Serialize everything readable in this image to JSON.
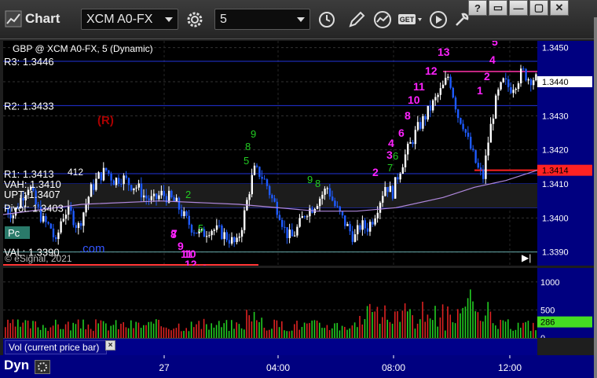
{
  "app": {
    "title": "Chart"
  },
  "toolbar": {
    "symbol": "XCM A0-FX",
    "interval": "5",
    "get_label": "GET"
  },
  "window_controls": [
    "?",
    "▭",
    "—",
    "▢",
    "✕"
  ],
  "chart": {
    "header": "GBP @ XCM A0-FX, 5 (Dynamic)",
    "copyright": "© eSignal, 2021",
    "watermark": ".com",
    "colors": {
      "background": "#000000",
      "axis_bg": "#000080",
      "up_candle": "#ffffff",
      "down_candle": "#1e5bff",
      "level_line": "#2233dd",
      "count_magenta": "#ff22ff",
      "count_green": "#22cc22"
    },
    "levels": [
      {
        "label": "R3: 1.3446",
        "price": 1.3446
      },
      {
        "label": "R2: 1.3433",
        "price": 1.3433
      },
      {
        "label": "R1: 1.3413",
        "price": 1.3413
      },
      {
        "label": "VAH: 1.3410",
        "price": 1.341
      },
      {
        "label": "UPT: 1.3407",
        "price": 1.3407
      },
      {
        "label": "Pivot: 1.3403",
        "price": 1.3403
      },
      {
        "label": "VAL: 1.3390",
        "price": 1.339
      }
    ],
    "r1_suffix": "412",
    "pc_box": "Pc",
    "r_marker": "(R)",
    "magenta_counts": [
      "13",
      "12",
      "11",
      "10",
      "8",
      "6",
      "4",
      "3",
      "2",
      "5",
      "4",
      "2",
      "1",
      "7",
      "8",
      "9",
      "10",
      "11",
      "12",
      "13"
    ],
    "green_counts": [
      "9",
      "8",
      "5",
      "9",
      "8",
      "7",
      "6",
      "2",
      "5"
    ],
    "price_axis_ticks": [
      "1.3450",
      "1.3440",
      "1.3430",
      "1.3420",
      "1.3410",
      "1.3400",
      "1.3390"
    ],
    "last_price": "1.3440",
    "r1_tag": "1.3414",
    "vol_ticks": [
      "1000",
      "500",
      "0"
    ],
    "vol_last": "286",
    "vol_label": "Vol (current price bar)",
    "time_ticks": [
      "27",
      "04:00",
      "08:00",
      "12:00"
    ],
    "dyn_label": "Dyn"
  },
  "chart_data": {
    "type": "candlestick",
    "ylim": [
      1.3386,
      1.3452
    ],
    "close_path": [
      [
        0,
        1.3403
      ],
      [
        12,
        1.3401
      ],
      [
        22,
        1.3406
      ],
      [
        32,
        1.341
      ],
      [
        40,
        1.3404
      ],
      [
        50,
        1.3399
      ],
      [
        60,
        1.3397
      ],
      [
        66,
        1.3392
      ],
      [
        72,
        1.3399
      ],
      [
        78,
        1.3402
      ],
      [
        86,
        1.3401
      ],
      [
        94,
        1.3397
      ],
      [
        100,
        1.3401
      ],
      [
        110,
        1.3408
      ],
      [
        120,
        1.3412
      ],
      [
        130,
        1.3414
      ],
      [
        140,
        1.3411
      ],
      [
        150,
        1.3412
      ],
      [
        160,
        1.341
      ],
      [
        170,
        1.3409
      ],
      [
        180,
        1.3406
      ],
      [
        190,
        1.3405
      ],
      [
        200,
        1.3407
      ],
      [
        210,
        1.3406
      ],
      [
        220,
        1.3404
      ],
      [
        230,
        1.34
      ],
      [
        240,
        1.3397
      ],
      [
        252,
        1.3395
      ],
      [
        262,
        1.3397
      ],
      [
        274,
        1.3396
      ],
      [
        286,
        1.3394
      ],
      [
        296,
        1.3392
      ],
      [
        304,
        1.3399
      ],
      [
        312,
        1.3408
      ],
      [
        318,
        1.3414
      ],
      [
        326,
        1.3413
      ],
      [
        334,
        1.341
      ],
      [
        342,
        1.3405
      ],
      [
        350,
        1.3402
      ],
      [
        358,
        1.3396
      ],
      [
        366,
        1.3394
      ],
      [
        376,
        1.3398
      ],
      [
        384,
        1.3402
      ],
      [
        392,
        1.3403
      ],
      [
        402,
        1.3406
      ],
      [
        412,
        1.3409
      ],
      [
        420,
        1.3404
      ],
      [
        430,
        1.34
      ],
      [
        438,
        1.3397
      ],
      [
        446,
        1.3394
      ],
      [
        454,
        1.3398
      ],
      [
        462,
        1.3397
      ],
      [
        470,
        1.34
      ],
      [
        478,
        1.3405
      ],
      [
        486,
        1.341
      ],
      [
        494,
        1.3407
      ],
      [
        502,
        1.3413
      ],
      [
        510,
        1.3418
      ],
      [
        518,
        1.3422
      ],
      [
        526,
        1.3426
      ],
      [
        534,
        1.3429
      ],
      [
        542,
        1.3432
      ],
      [
        550,
        1.3435
      ],
      [
        558,
        1.3438
      ],
      [
        566,
        1.3442
      ],
      [
        572,
        1.3436
      ],
      [
        578,
        1.343
      ],
      [
        584,
        1.3428
      ],
      [
        590,
        1.3423
      ],
      [
        596,
        1.3419
      ],
      [
        604,
        1.3414
      ],
      [
        610,
        1.3412
      ],
      [
        616,
        1.3422
      ],
      [
        622,
        1.343
      ],
      [
        628,
        1.3436
      ],
      [
        636,
        1.344
      ],
      [
        644,
        1.3438
      ],
      [
        652,
        1.344
      ],
      [
        660,
        1.3443
      ],
      [
        668,
        1.3441
      ],
      [
        676,
        1.3441
      ],
      [
        680,
        1.344
      ]
    ],
    "value_area_line": [
      [
        0,
        1.3401
      ],
      [
        100,
        1.3404
      ],
      [
        200,
        1.3405
      ],
      [
        300,
        1.3404
      ],
      [
        400,
        1.3402
      ],
      [
        450,
        1.3402
      ],
      [
        500,
        1.3403
      ],
      [
        560,
        1.3406
      ],
      [
        600,
        1.3409
      ],
      [
        640,
        1.3411
      ],
      [
        680,
        1.3414
      ]
    ],
    "volume_ylim": [
      0,
      1250
    ]
  }
}
